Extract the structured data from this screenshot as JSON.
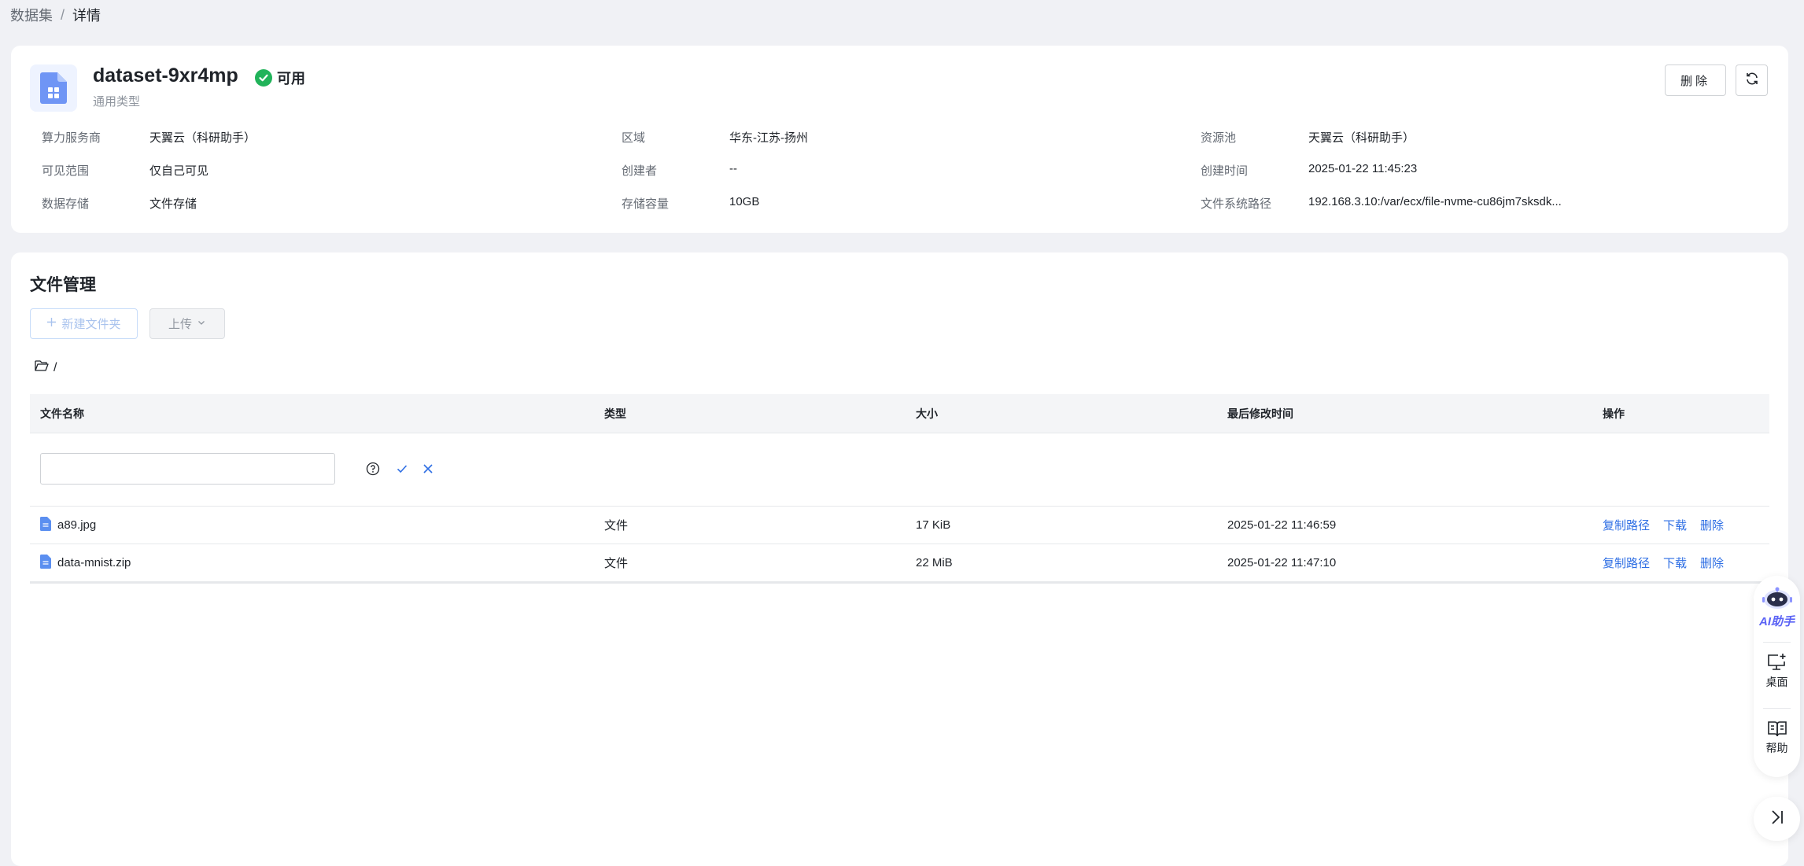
{
  "breadcrumb": {
    "parent": "数据集",
    "separator": "/",
    "current": "详情"
  },
  "dataset": {
    "name": "dataset-9xr4mp",
    "status": "可用",
    "status_color": "#21b35a",
    "type": "通用类型",
    "delete_label": "删除",
    "icon": "dataset-file-icon",
    "refresh_icon": "refresh-icon"
  },
  "info": {
    "provider_key": "算力服务商",
    "provider_val": "天翼云（科研助手）",
    "region_key": "区域",
    "region_val": "华东-江苏-扬州",
    "pool_key": "资源池",
    "pool_val": "天翼云（科研助手）",
    "visibility_key": "可见范围",
    "visibility_val": "仅自己可见",
    "creator_key": "创建者",
    "creator_val": "--",
    "created_key": "创建时间",
    "created_val": "2025-01-22 11:45:23",
    "storage_key": "数据存储",
    "storage_val": "文件存储",
    "capacity_key": "存储容量",
    "capacity_val": "10GB",
    "path_key": "文件系统路径",
    "path_val": "192.168.3.10:/var/ecx/file-nvme-cu86jm7sksdk..."
  },
  "files": {
    "title": "文件管理",
    "new_folder_label": "新建文件夹",
    "upload_label": "上传",
    "current_path": "/",
    "columns": {
      "name": "文件名称",
      "type": "类型",
      "size": "大小",
      "modified": "最后修改时间",
      "ops": "操作"
    },
    "rows": [
      {
        "name": "a89.jpg",
        "type": "文件",
        "size": "17 KiB",
        "modified": "2025-01-22 11:46:59",
        "op_copy": "复制路径",
        "op_download": "下载",
        "op_delete": "删除"
      },
      {
        "name": "data-mnist.zip",
        "type": "文件",
        "size": "22 MiB",
        "modified": "2025-01-22 11:47:10",
        "op_copy": "复制路径",
        "op_download": "下载",
        "op_delete": "删除"
      }
    ]
  },
  "float_panel": {
    "ai_label": "AI助手",
    "desktop_label": "桌面",
    "help_label": "帮助"
  },
  "colors": {
    "accent": "#2f6fe4",
    "page_bg": "#f0f1f5"
  }
}
